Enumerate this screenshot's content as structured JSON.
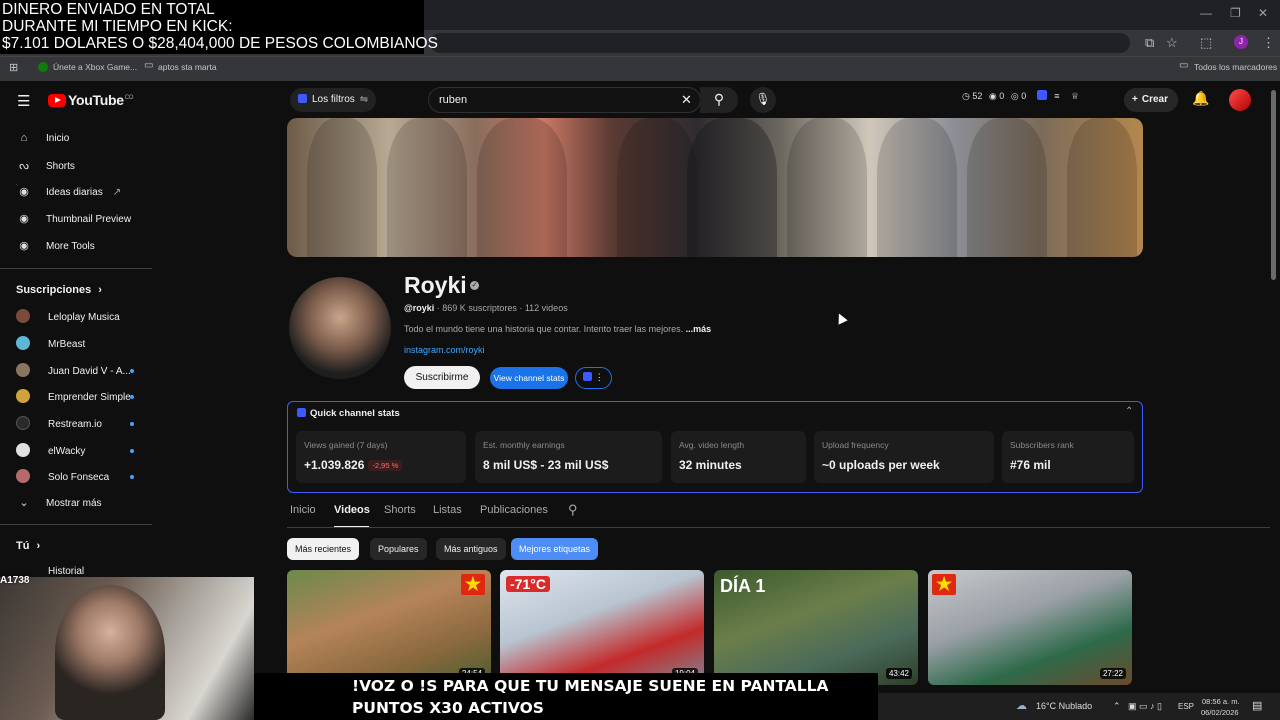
{
  "overlay": {
    "title_lines": "DINERO ENVIADO EN TOTAL\nDURANTE MI TIEMPO EN KICK:\n$7.101 DOLARES O $28,404,000 DE PESOS COLOMBIANOS",
    "ticker_lines": "!VOZ O !S PARA QUE TU MENSAJE SUENE EN PANTALLA\nPUNTOS X30 ACTIVOS",
    "cam_user": "A1738"
  },
  "browser": {
    "bookmarks": [
      "Únete a Xbox Game...",
      "aptos sta marta"
    ],
    "all_bookmarks": "Todos los marcadores",
    "profile_initial": "J"
  },
  "yt": {
    "logo": "YouTube",
    "country": "CO",
    "filters_label": "Los filtros",
    "search_value": "ruben",
    "stats": {
      "a": "52",
      "b": "0",
      "c": "0"
    },
    "create_label": "Crear"
  },
  "sidebar": {
    "items": [
      {
        "label": "Inicio",
        "icon": "home-icon"
      },
      {
        "label": "Shorts",
        "icon": "shorts-icon"
      },
      {
        "label": "Ideas diarias",
        "icon": "ideas-icon"
      },
      {
        "label": "Thumbnail Preview",
        "icon": "thumbnail-icon"
      },
      {
        "label": "More Tools",
        "icon": "tools-icon"
      }
    ],
    "subs_title": "Suscripciones",
    "subs": [
      {
        "label": "Leloplay Musica",
        "color": "#7a4b3a"
      },
      {
        "label": "MrBeast",
        "color": "#5fb7d6"
      },
      {
        "label": "Juan David V - A...",
        "color": "#8a7560"
      },
      {
        "label": "Emprender Simple",
        "color": "#d1a23b"
      },
      {
        "label": "Restream.io",
        "color": "#2a2a2a"
      },
      {
        "label": "elWacky",
        "color": "#e0e0e0"
      },
      {
        "label": "Solo Fonseca",
        "color": "#b56b6b"
      }
    ],
    "show_more": "Mostrar más",
    "you_title": "Tú",
    "history": "Historial"
  },
  "channel": {
    "name": "Royki",
    "handle": "@royki",
    "meta": " · 869 K suscriptores · 112 videos",
    "description": "Todo el mundo tiene una historia que contar. Intento traer las mejores. ",
    "more": "...más",
    "link": "instagram.com/royki",
    "subscribe": "Suscribirme",
    "stats_btn": "View channel stats"
  },
  "quick_stats": {
    "title": "Quick channel stats",
    "cards": [
      {
        "label": "Views gained (7 days)",
        "value": "+1.039.826",
        "delta": "-2,95 %"
      },
      {
        "label": "Est. monthly earnings",
        "value": "8 mil US$ - 23 mil US$"
      },
      {
        "label": "Avg. video length",
        "value": "32 minutes"
      },
      {
        "label": "Upload frequency",
        "value": "~0 uploads per week"
      },
      {
        "label": "Subscribers rank",
        "value": "#76 mil"
      }
    ]
  },
  "tabs": [
    "Inicio",
    "Videos",
    "Shorts",
    "Listas",
    "Publicaciones"
  ],
  "chips": [
    "Más recientes",
    "Populares",
    "Más antiguos",
    "Mejores etiquetas"
  ],
  "videos": [
    {
      "duration": "24:54",
      "overlay": ""
    },
    {
      "duration": "19:04",
      "overlay": "-71°C"
    },
    {
      "duration": "43:42",
      "overlay": "DÍA 1"
    },
    {
      "duration": "27:22",
      "overlay": ""
    }
  ],
  "taskbar": {
    "weather": "16°C  Nublado",
    "lang": "ESP",
    "time": "08:56 a. m.",
    "date": "06/02/2026"
  }
}
